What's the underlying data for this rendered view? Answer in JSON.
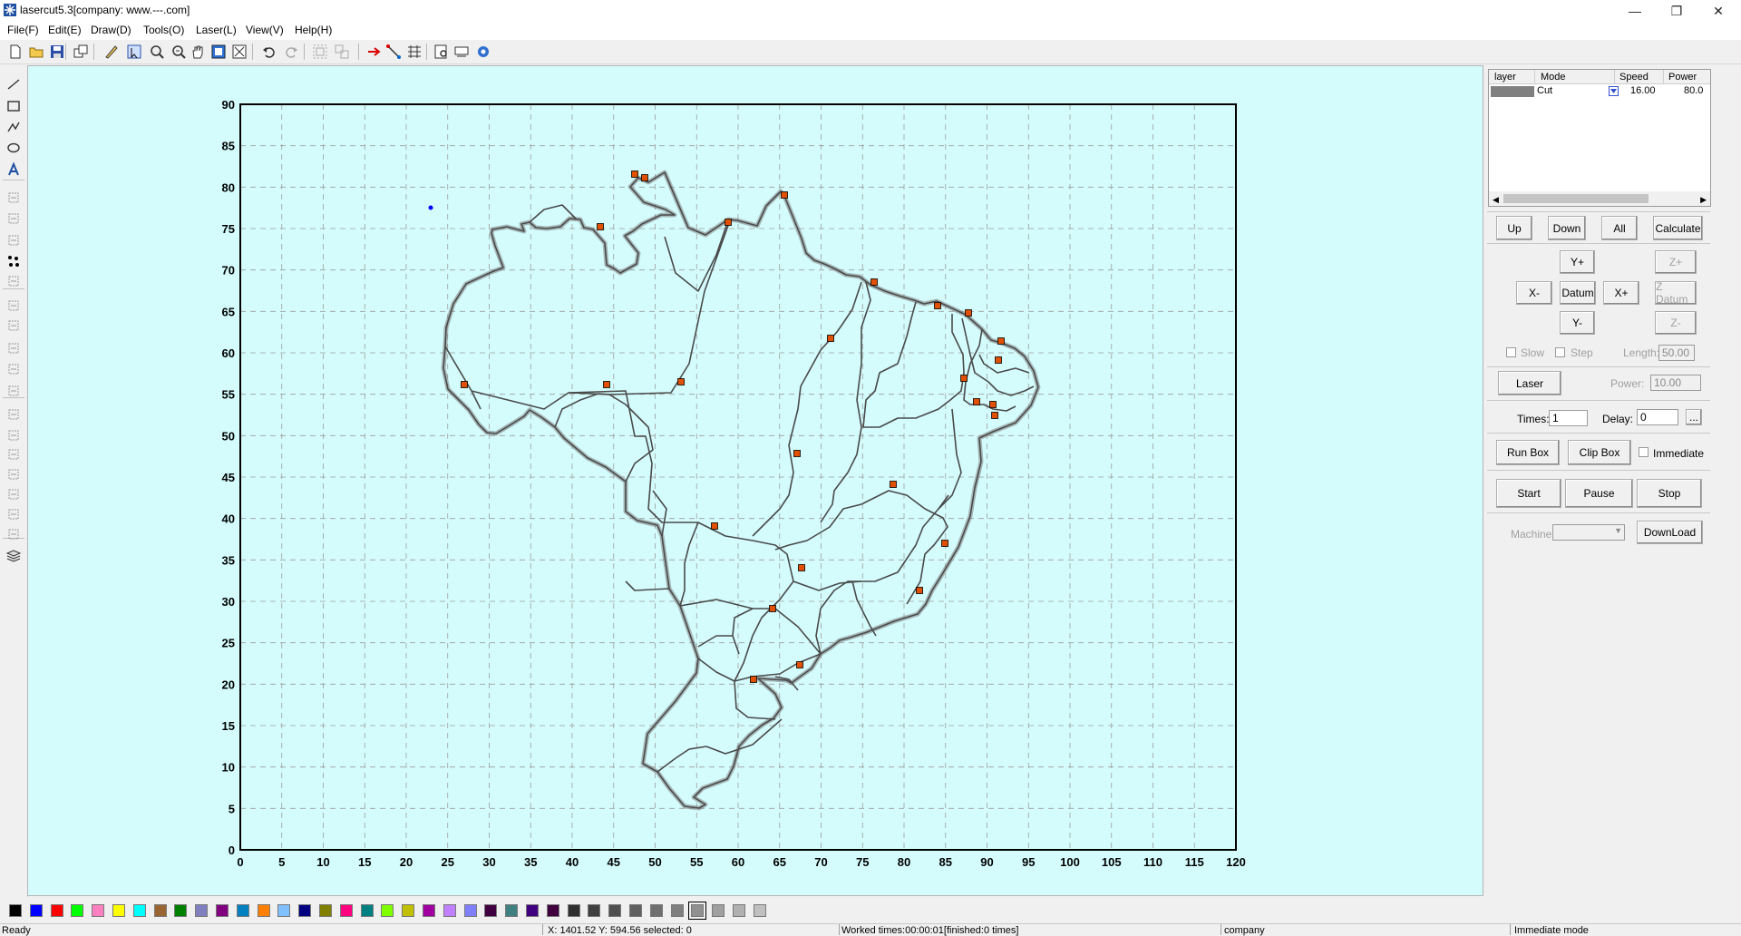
{
  "window": {
    "title": "lasercut5.3[company: www.---.com]",
    "minimize_glyph": "—",
    "maximize_glyph": "❐",
    "close_glyph": "✕"
  },
  "menu": [
    "File(F)",
    "Edit(E)",
    "Draw(D)",
    "Tools(O)",
    "Laser(L)",
    "View(V)",
    "Help(H)"
  ],
  "toolbar": {
    "icons": [
      "new-file-icon",
      "open-folder-icon",
      "save-icon",
      "import-icon",
      "edit-nodes-icon",
      "select-icon",
      "zoom-window-icon",
      "zoom-icon",
      "pan-hand-icon",
      "zoom-page-icon",
      "zoom-fit-icon",
      "undo-icon",
      "redo-icon",
      "group-icon",
      "ungroup-icon",
      "laser-start-point-icon",
      "cut-path-icon",
      "array-icon",
      "preview-icon",
      "output-icon",
      "settings-icon"
    ]
  },
  "left_tools": [
    "line-tool-icon",
    "rectangle-tool-icon",
    "polyline-tool-icon",
    "ellipse-tool-icon",
    "text-tool-icon",
    "rotate-icon",
    "mirror-horizontal-icon",
    "mirror-vertical-icon",
    "node-edit-icon",
    "scale-icon",
    "array-copy-icon",
    "hatch-icon",
    "fill-icon",
    "engrave-icon",
    "wave-icon",
    "align-left-icon",
    "align-right-icon",
    "align-top-icon",
    "align-bottom-icon",
    "center-horizontal-icon",
    "center-vertical-icon",
    "center-both-icon",
    "layers-icon"
  ],
  "canvas": {
    "background": "#d4fcfd",
    "x_ticks": [
      "0",
      "5",
      "10",
      "15",
      "20",
      "25",
      "30",
      "35",
      "40",
      "45",
      "50",
      "55",
      "60",
      "65",
      "70",
      "75",
      "80",
      "85",
      "90",
      "95",
      "100",
      "105",
      "110",
      "115",
      "120"
    ],
    "y_ticks": [
      "90",
      "85",
      "80",
      "75",
      "70",
      "65",
      "60",
      "55",
      "50",
      "45",
      "40",
      "35",
      "30",
      "25",
      "20",
      "15",
      "10",
      "5",
      "0"
    ],
    "path_color": "#4a4a4a",
    "start_marker_color": "#e05000"
  },
  "layers": {
    "headers": [
      "layer",
      "Mode",
      "Speed",
      "Power"
    ],
    "rows": [
      {
        "color": "#808080",
        "mode": "Cut",
        "speed": "16.00",
        "power": "80.0"
      }
    ]
  },
  "buttons": {
    "up": "Up",
    "down": "Down",
    "all": "All",
    "calculate": "Calculate",
    "y_plus": "Y+",
    "y_minus": "Y-",
    "x_minus": "X-",
    "x_plus": "X+",
    "datum": "Datum",
    "z_plus": "Z+",
    "z_datum": "Z Datum",
    "z_minus": "Z-",
    "laser": "Laser",
    "run_box": "Run Box",
    "clip_box": "Clip Box",
    "start": "Start",
    "pause": "Pause",
    "stop": "Stop",
    "download": "DownLoad",
    "ellipsis": "..."
  },
  "controls": {
    "slow": "Slow",
    "step": "Step",
    "length_label": "Length:",
    "length_value": "50.00",
    "power_label": "Power:",
    "power_value": "10.00",
    "times_label": "Times:",
    "times_value": "1",
    "delay_label": "Delay:",
    "delay_value": "0",
    "immediate": "Immediate",
    "machine_label": "Machine:"
  },
  "palette": [
    "#000000",
    "#0000ff",
    "#ff0000",
    "#00ff00",
    "#ff80c0",
    "#ffff00",
    "#00ffff",
    "#996633",
    "#008000",
    "#8080c0",
    "#800080",
    "#0080c0",
    "#ff8000",
    "#80c0ff",
    "#000080",
    "#808000",
    "#ff0080",
    "#008080",
    "#80ff00",
    "#c0c000",
    "#a000a0",
    "#c080ff",
    "#8080ff",
    "#400040",
    "#408080",
    "#400080",
    "#400040",
    "#303030",
    "#404040",
    "#505050",
    "#606060",
    "#707070",
    "#808080",
    "#909090",
    "#a0a0a0",
    "#b0b0b0",
    "#c0c0c0"
  ],
  "status": {
    "ready": "Ready",
    "coords": "X: 1401.52 Y: 594.56 selected: 0",
    "worked": "Worked times:00:00:01[finished:0 times]",
    "company": "company",
    "mode": "Immediate mode"
  }
}
